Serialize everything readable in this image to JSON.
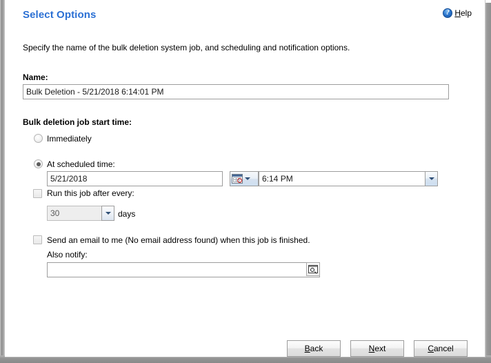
{
  "header": {
    "title": "Select Options",
    "help": {
      "icon": "help-circle-icon",
      "accel": "H",
      "rest": "elp"
    }
  },
  "intro": "Specify the name of the bulk deletion system job, and scheduling and notification options.",
  "name_section": {
    "label": "Name:",
    "value": "Bulk Deletion - 5/21/2018 6:14:01 PM",
    "placeholder": ""
  },
  "start_time_section": {
    "label": "Bulk deletion job start time:",
    "immediately": {
      "label": "Immediately",
      "checked": false
    },
    "scheduled": {
      "label": "At scheduled time:",
      "checked": true
    },
    "date": {
      "value": "5/21/2018",
      "placeholder": ""
    },
    "date_picker": {
      "icon": "calendar-icon",
      "arrow": "chevron-down-icon"
    },
    "time": {
      "value": "6:14 PM",
      "placeholder": ""
    },
    "time_dropdown": {
      "arrow": "chevron-down-icon"
    },
    "recurrence": {
      "label": "Run this job after every:",
      "checked": false,
      "interval_value": "30",
      "unit_label": "days",
      "enabled": false
    }
  },
  "notification_section": {
    "email_label": "Send an email to me (No email address found) when this job is finished.",
    "email_checked": false,
    "also_notify_label": "Also notify:",
    "also_notify_value": "",
    "also_notify_placeholder": "",
    "lookup_icon": "lookup-search-icon"
  },
  "footer": {
    "back": {
      "accel": "B",
      "rest": "ack"
    },
    "next": {
      "accel": "N",
      "rest": "ext"
    },
    "cancel": {
      "accel": "C",
      "rest": "ancel"
    }
  },
  "colors": {
    "title_blue": "#2b70d4",
    "dialog_bg": "#ffffff",
    "chrome_grey": "#9a9a9a",
    "calendar_red": "#cc2222"
  }
}
